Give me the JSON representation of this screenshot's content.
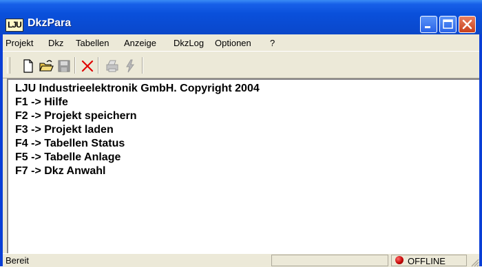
{
  "window": {
    "app_icon_text": "LJU",
    "title": "DkzPara",
    "title_buttons": [
      "minimize-icon",
      "maximize-icon",
      "close-icon"
    ]
  },
  "menu": [
    {
      "label": "Projekt"
    },
    {
      "label": "Dkz"
    },
    {
      "label": "Tabellen"
    },
    {
      "label": "Anzeige"
    },
    {
      "label": "DkzLog"
    },
    {
      "label": "Optionen"
    },
    {
      "label": "?"
    }
  ],
  "toolbar": {
    "tools": [
      {
        "icon": "new-file-icon",
        "enabled": true
      },
      {
        "icon": "open-folder-icon",
        "enabled": true
      },
      {
        "icon": "save-disk-icon",
        "enabled": false
      },
      {
        "icon": "delete-x-icon",
        "enabled": true
      },
      {
        "icon": "print-icon",
        "enabled": false
      },
      {
        "icon": "connect-lightning-icon",
        "enabled": false
      }
    ]
  },
  "content": {
    "lines": [
      "LJU Industrieelektronik GmbH. Copyright 2004",
      "F1 -> Hilfe",
      "F2 -> Projekt speichern",
      "F3 -> Projekt laden",
      "F4 -> Tabellen Status",
      "F5 -> Tabelle Anlage",
      "F7 -> Dkz Anwahl"
    ]
  },
  "status": {
    "left_text": "Bereit",
    "connection_text": "OFFLINE",
    "connection_color": "#cc0000"
  },
  "colors": {
    "titlebar": "#0a50db",
    "chrome": "#ece9d8",
    "close_button": "#c8401c"
  }
}
